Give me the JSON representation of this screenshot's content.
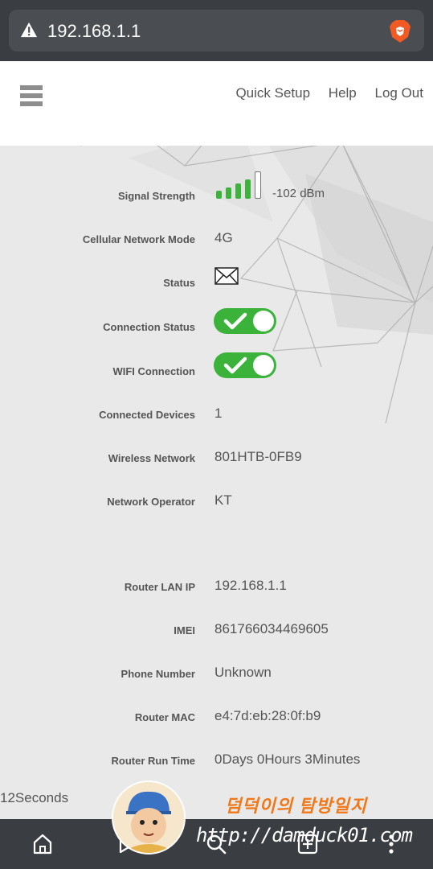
{
  "browser": {
    "url": "192.168.1.1",
    "icons": {
      "warning": "warning-triangle-icon",
      "brave": "brave-lion-icon"
    }
  },
  "header": {
    "links": [
      "Quick Setup",
      "Help",
      "Log Out"
    ]
  },
  "status": {
    "signal_strength": {
      "label": "Signal Strength",
      "value": "-102 dBm",
      "bars_filled": 4,
      "bars_total": 5
    },
    "network_mode": {
      "label": "Cellular Network Mode",
      "value": "4G"
    },
    "status": {
      "label": "Status"
    },
    "connection_status": {
      "label": "Connection Status",
      "on": true
    },
    "wifi_connection": {
      "label": "WIFI Connection",
      "on": true
    },
    "connected_devices": {
      "label": "Connected Devices",
      "value": "1"
    },
    "wireless_network": {
      "label": "Wireless Network",
      "value": "801HTB-0FB9"
    },
    "network_operator": {
      "label": "Network Operator",
      "value": "KT"
    },
    "router_lan_ip": {
      "label": "Router LAN IP",
      "value": "192.168.1.1"
    },
    "imei": {
      "label": "IMEI",
      "value": "861766034469605"
    },
    "phone_number": {
      "label": "Phone Number",
      "value": "Unknown"
    },
    "router_mac": {
      "label": "Router MAC",
      "value": "e4:7d:eb:28:0f:b9"
    },
    "router_run_time": {
      "label": "Router Run Time",
      "value": "0Days 0Hours 3Minutes",
      "overflow": "12Seconds"
    }
  },
  "watermark": {
    "korean": "덤덕이의 탐방일지",
    "url": "http://damduck01.com"
  },
  "colors": {
    "toggle_on": "#3bb33b",
    "signal": "#3db33d",
    "brand_orange": "#f07818"
  }
}
